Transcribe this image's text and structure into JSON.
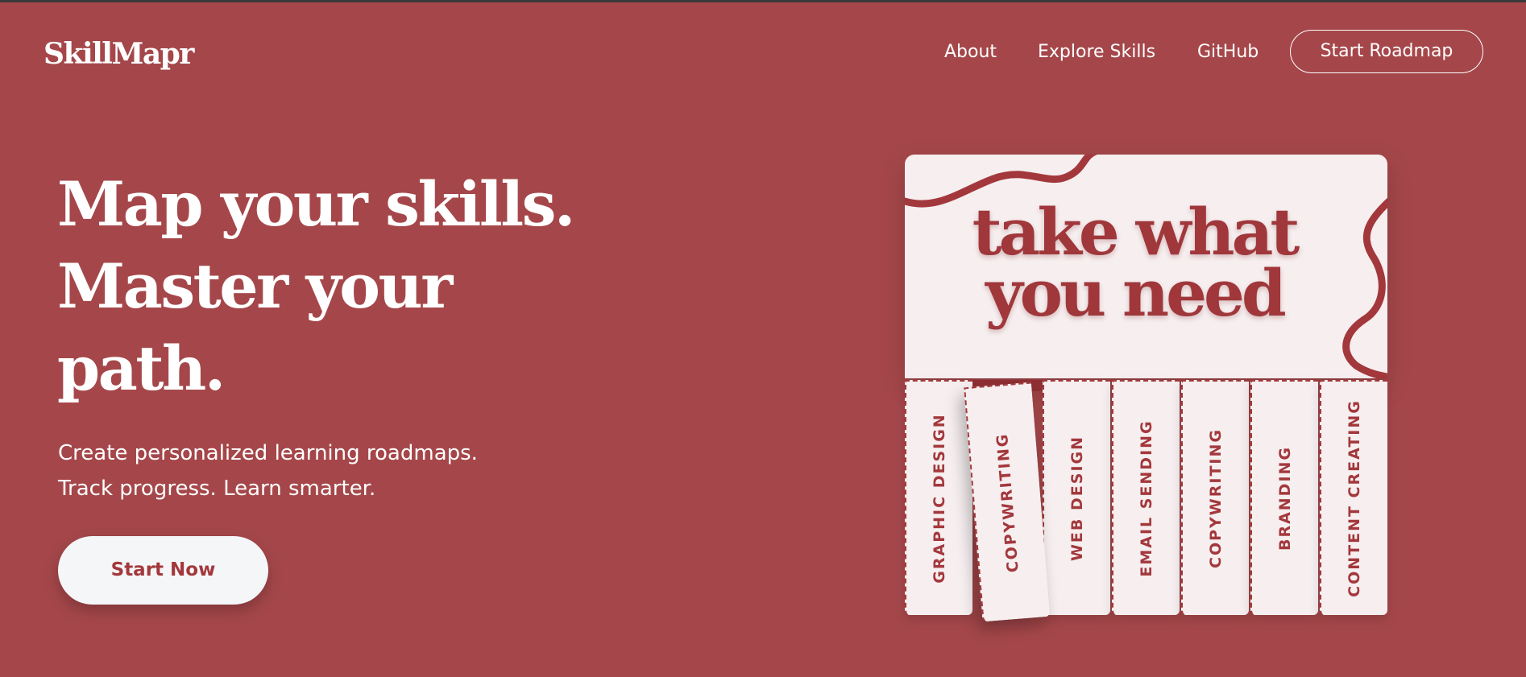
{
  "brand": {
    "name": "SkillMapr"
  },
  "nav": {
    "links": [
      "About",
      "Explore Skills",
      "GitHub"
    ],
    "cta_label": "Start Roadmap"
  },
  "hero": {
    "title_lines": [
      "Map your skills.",
      "Master your",
      "path."
    ],
    "subtitle_lines": [
      "Create personalized learning roadmaps.",
      "Track progress. Learn smarter."
    ],
    "cta_label": "Start Now"
  },
  "poster": {
    "title_lines": [
      "take what",
      "you need"
    ],
    "tabs": [
      "GRAPHIC DESIGN",
      "COPYWRITING",
      "WEB DESIGN",
      "EMAIL SENDING",
      "COPYWRITING",
      "BRANDING",
      "CONTENT CREATING"
    ]
  },
  "colors": {
    "background": "#a5474a",
    "accent": "#a3383c",
    "light": "#f6eeef"
  }
}
